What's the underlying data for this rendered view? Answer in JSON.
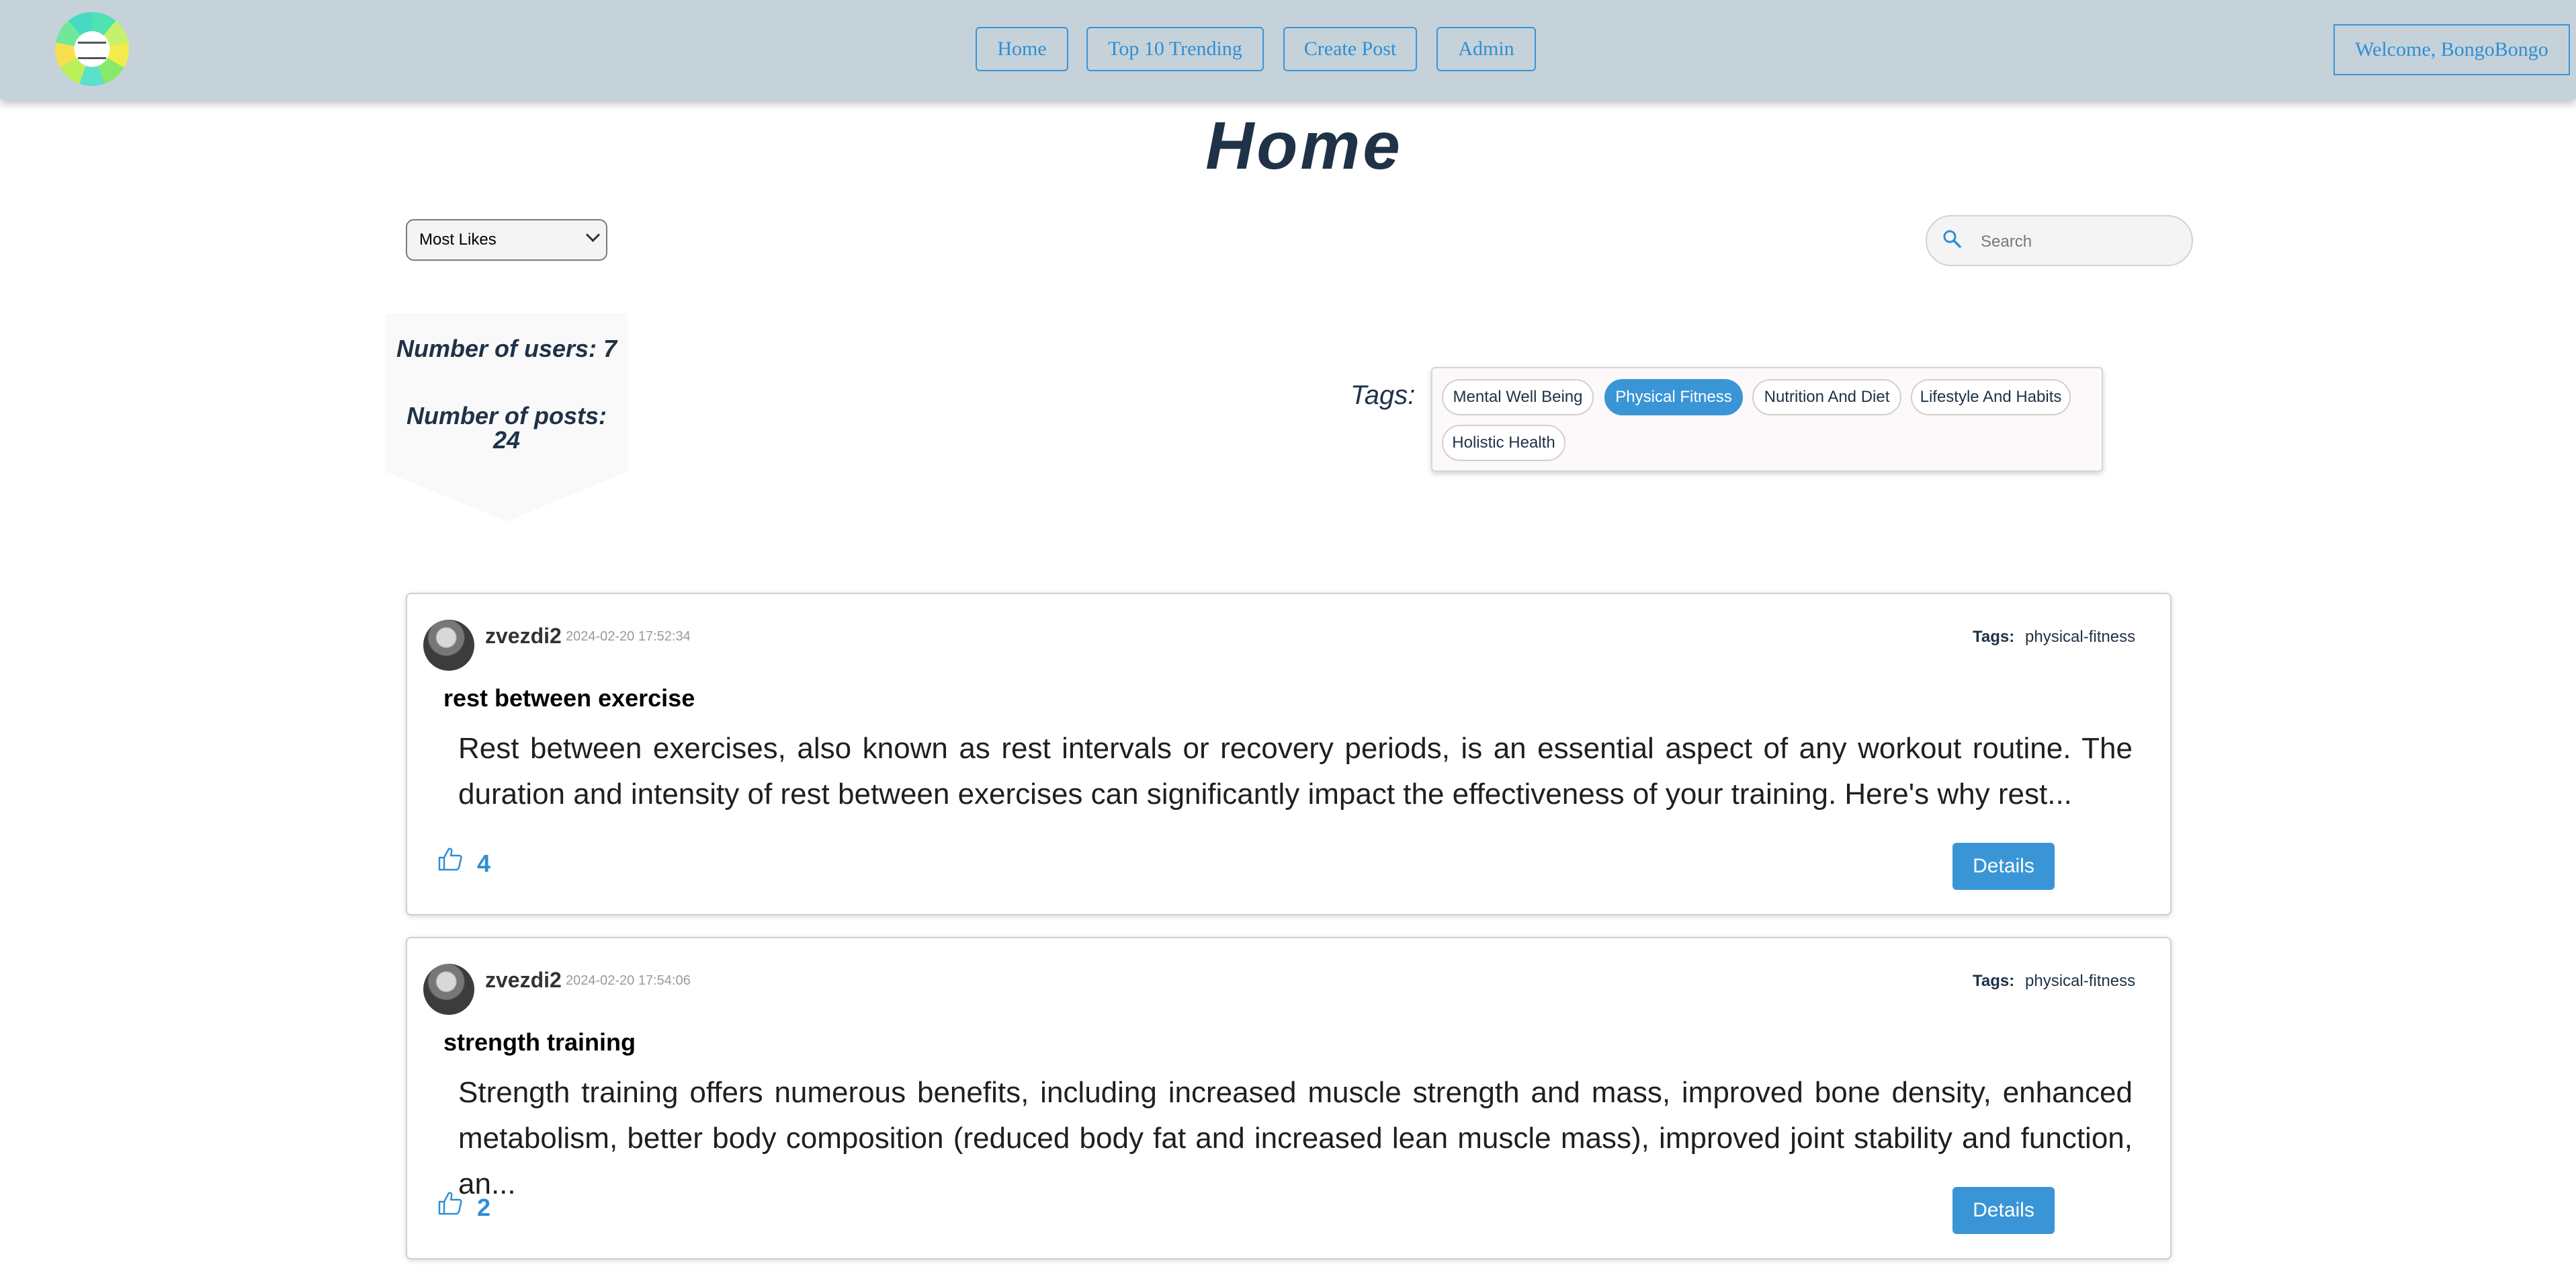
{
  "header": {
    "nav": [
      "Home",
      "Top 10 Trending",
      "Create Post",
      "Admin"
    ],
    "welcome": "Welcome, BongoBongo"
  },
  "page_title": "Home",
  "sort": {
    "selected": "Most Likes"
  },
  "search": {
    "placeholder": "Search"
  },
  "stats": {
    "users_label": "Number of users: 7",
    "posts_label_line1": "Number of posts:",
    "posts_label_line2": "24"
  },
  "tags": {
    "label": "Tags:",
    "items": [
      "Mental Well Being",
      "Physical Fitness",
      "Nutrition And Diet",
      "Lifestyle And Habits",
      "Holistic Health"
    ],
    "active": "Physical Fitness"
  },
  "posts": [
    {
      "author": "zvezdi2",
      "date": "2024-02-20 17:52:34",
      "tags_label": "Tags:",
      "tag": "physical-fitness",
      "title": "rest between exercise",
      "body": "Rest between exercises, also known as rest intervals or recovery periods, is an essential aspect of any workout routine. The duration and intensity of rest between exercises can significantly impact the effectiveness of your training. Here's why rest...",
      "likes": "4",
      "details_label": "Details"
    },
    {
      "author": "zvezdi2",
      "date": "2024-02-20 17:54:06",
      "tags_label": "Tags:",
      "tag": "physical-fitness",
      "title": "strength training",
      "body": "Strength training offers numerous benefits, including increased muscle strength and mass, improved bone density, enhanced metabolism, better body composition (reduced body fat and increased lean muscle mass), improved joint stability and function, an...",
      "likes": "2",
      "details_label": "Details"
    }
  ],
  "colors": {
    "header_bg": "#c5d2da",
    "accent": "#3a95d6",
    "title": "#1f3247"
  },
  "icons": [
    "search-icon",
    "thumbs-up-icon",
    "chevron-down-icon"
  ]
}
